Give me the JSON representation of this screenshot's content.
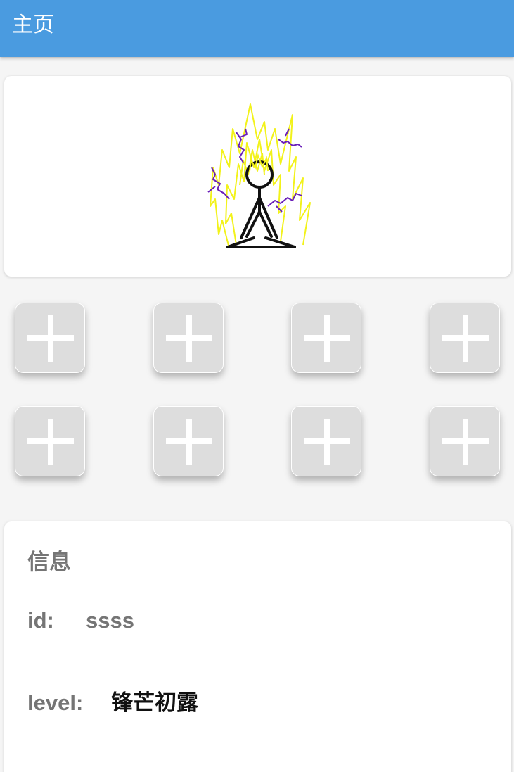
{
  "appbar": {
    "title": "主页",
    "color": "#4a9be0"
  },
  "hero": {
    "image_icon": "meditating-stick-figure-with-aura-icon"
  },
  "slots": {
    "icon": "plus-icon",
    "items": [
      {
        "label": "+"
      },
      {
        "label": "+"
      },
      {
        "label": "+"
      },
      {
        "label": "+"
      },
      {
        "label": "+"
      },
      {
        "label": "+"
      },
      {
        "label": "+"
      },
      {
        "label": "+"
      }
    ]
  },
  "info": {
    "heading": "信息",
    "id_label": "id:",
    "id_value": "ssss",
    "level_label": "level:",
    "level_value": "锋芒初露"
  }
}
